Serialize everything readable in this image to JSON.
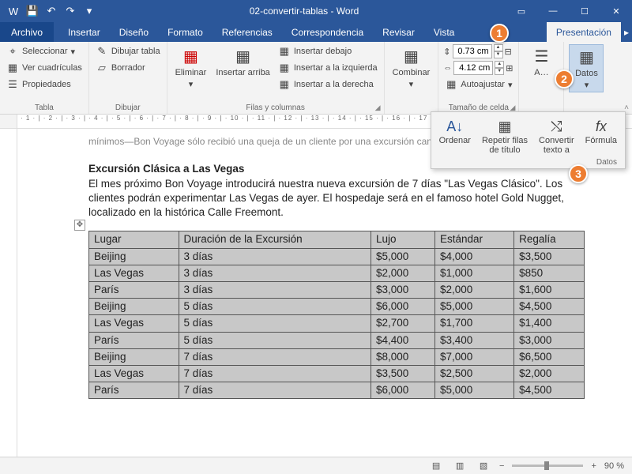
{
  "title": "02-convertir-tablas - Word",
  "qat": {
    "save": "💾",
    "undo": "↶",
    "redo": "↷",
    "more": "▾"
  },
  "tabs": {
    "file": "Archivo",
    "items": [
      "Insertar",
      "Diseño",
      "Formato",
      "Referencias",
      "Correspondencia",
      "Revisar",
      "Vista"
    ],
    "tool": "Presentación"
  },
  "ribbon": {
    "tabla": {
      "select": "Seleccionar",
      "grid": "Ver cuadrículas",
      "props": "Propiedades",
      "label": "Tabla"
    },
    "dibujar": {
      "draw": "Dibujar tabla",
      "eraser": "Borrador",
      "label": "Dibujar"
    },
    "filas": {
      "delete": "Eliminar",
      "insert_up": "Insertar arriba",
      "insert_below": "Insertar debajo",
      "insert_left": "Insertar a la izquierda",
      "insert_right": "Insertar a la derecha",
      "label": "Filas y columnas"
    },
    "combinar": {
      "label": "Combinar"
    },
    "tamano": {
      "h": "0.73 cm",
      "w": "4.12 cm",
      "auto": "Autoajustar",
      "label": "Tamaño de celda"
    },
    "alineacion": {
      "label": "Alineación"
    },
    "datos": {
      "label": "Datos"
    }
  },
  "dropdown": {
    "ordenar": "Ordenar",
    "repetir1": "Repetir filas",
    "repetir2": "de título",
    "convertir1": "Convertir",
    "convertir2": "texto a",
    "formula": "Fórmula",
    "label": "Datos"
  },
  "doc": {
    "line0": "mínimos—Bon Voyage sólo recibió una queja de un cliente por una excursión cancelada.",
    "heading": "Excursión Clásica a Las Vegas",
    "p1": "El mes próximo Bon Voyage introducirá nuestra nueva excursión de 7 días \"Las Vegas Clásico\". Los clientes podrán experimentar Las Vegas de ayer. El hospedaje será en el famoso hotel Gold Nugget, localizado en la histórica Calle Freemont."
  },
  "table": {
    "headers": [
      "Lugar",
      "Duración de la Excursión",
      "Lujo",
      "Estándar",
      "Regalía"
    ],
    "rows": [
      [
        "Beijing",
        "3 días",
        "$5,000",
        "$4,000",
        "$3,500"
      ],
      [
        "Las Vegas",
        "3 días",
        "$2,000",
        "$1,000",
        "$850"
      ],
      [
        "París",
        "3 días",
        "$3,000",
        "$2,000",
        "$1,600"
      ],
      [
        "Beijing",
        "5 días",
        "$6,000",
        "$5,000",
        "$4,500"
      ],
      [
        "Las Vegas",
        "5 días",
        "$2,700",
        "$1,700",
        "$1,400"
      ],
      [
        "París",
        "5 días",
        "$4,400",
        "$3,400",
        "$3,000"
      ],
      [
        "Beijing",
        "7 días",
        "$8,000",
        "$7,000",
        "$6,500"
      ],
      [
        "Las Vegas",
        "7 días",
        "$3,500",
        "$2,500",
        "$2,000"
      ],
      [
        "París",
        "7 días",
        "$6,000",
        "$5,000",
        "$4,500"
      ]
    ]
  },
  "ruler": " · 1 · | · 2 · | · 3 · | · 4 · | · 5 · | · 6 · | · 7 · | · 8 · | · 9 · | · 10 · | · 11 · | · 12 · | · 13 · | · 14 · | · 15 · | · 16 · | · 17 ",
  "status": {
    "zoom": "90 %"
  },
  "callouts": {
    "c1": "1",
    "c2": "2",
    "c3": "3"
  }
}
